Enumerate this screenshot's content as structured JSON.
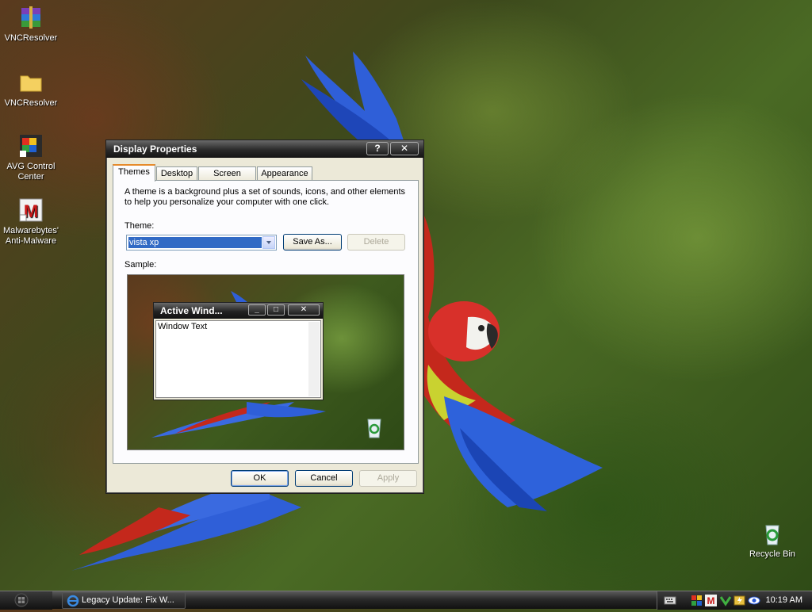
{
  "desktop": {
    "icons": [
      {
        "label": "VNCResolver",
        "icon": "winrar-archive-icon"
      },
      {
        "label": "VNCResolver",
        "icon": "folder-icon"
      },
      {
        "label": "AVG Control Center",
        "icon": "avg-shortcut-icon"
      },
      {
        "label": "Malwarebytes' Anti-Malware",
        "icon": "malwarebytes-shortcut-icon"
      },
      {
        "label": "Recycle Bin",
        "icon": "recycle-bin-icon"
      }
    ]
  },
  "dialog": {
    "title": "Display Properties",
    "help_button": "?",
    "close_button": "✕",
    "tabs": [
      "Themes",
      "Desktop",
      "Screen Saver",
      "Appearance"
    ],
    "active_tab": "Themes",
    "description": "A theme is a background plus a set of sounds, icons, and other elements to help you personalize your computer with one click.",
    "theme_label": "Theme:",
    "theme_value": "vista xp",
    "save_as_label": "Save As...",
    "delete_label": "Delete",
    "sample_label": "Sample:",
    "preview_window": {
      "title": "Active Wind...",
      "body_text": "Window Text"
    },
    "ok_label": "OK",
    "cancel_label": "Cancel",
    "apply_label": "Apply"
  },
  "taskbar": {
    "task_label": "Legacy Update: Fix W...",
    "clock": "10:19 AM",
    "tray_icons": [
      "keyboard-icon",
      "network-icon",
      "malwarebytes-tray-icon",
      "avg-tray-icon",
      "power-icon",
      "vnc-eye-icon"
    ]
  }
}
